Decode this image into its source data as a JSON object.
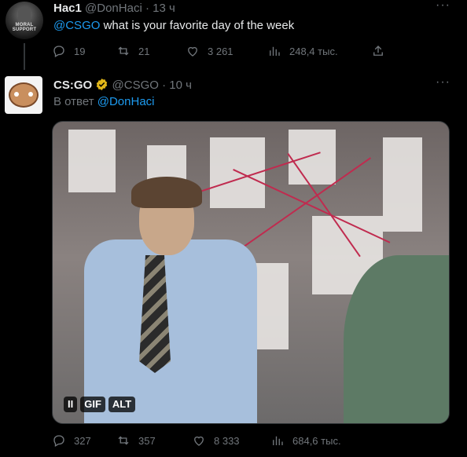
{
  "tweet1": {
    "author_name": "Hac1",
    "author_handle": "@DonHaci",
    "time_ago": "13 ч",
    "avatar_caption": "MORAL SUPPORT",
    "text_mention": "@CSGO",
    "text_body": " what is your favorite day of the week",
    "replies": "19",
    "retweets": "21",
    "likes": "3 261",
    "views": "248,4 тыс."
  },
  "tweet2": {
    "author_name": "CS:GO",
    "author_handle": "@CSGO",
    "time_ago": "10 ч",
    "reply_prefix": "В ответ",
    "reply_handle": "@DonHaci",
    "media_badges": [
      "GIF",
      "ALT"
    ],
    "replies": "327",
    "retweets": "357",
    "likes": "8 333",
    "views": "684,6 тыс."
  },
  "colors": {
    "background": "#000000",
    "text_primary": "#e7e9ea",
    "text_secondary": "#71767b",
    "accent": "#1d9bf0",
    "verified_gold": "#e2b719"
  },
  "icons": [
    "reply-icon",
    "retweet-icon",
    "like-icon",
    "views-icon",
    "share-icon",
    "more-icon",
    "verified-icon",
    "pause-icon"
  ]
}
